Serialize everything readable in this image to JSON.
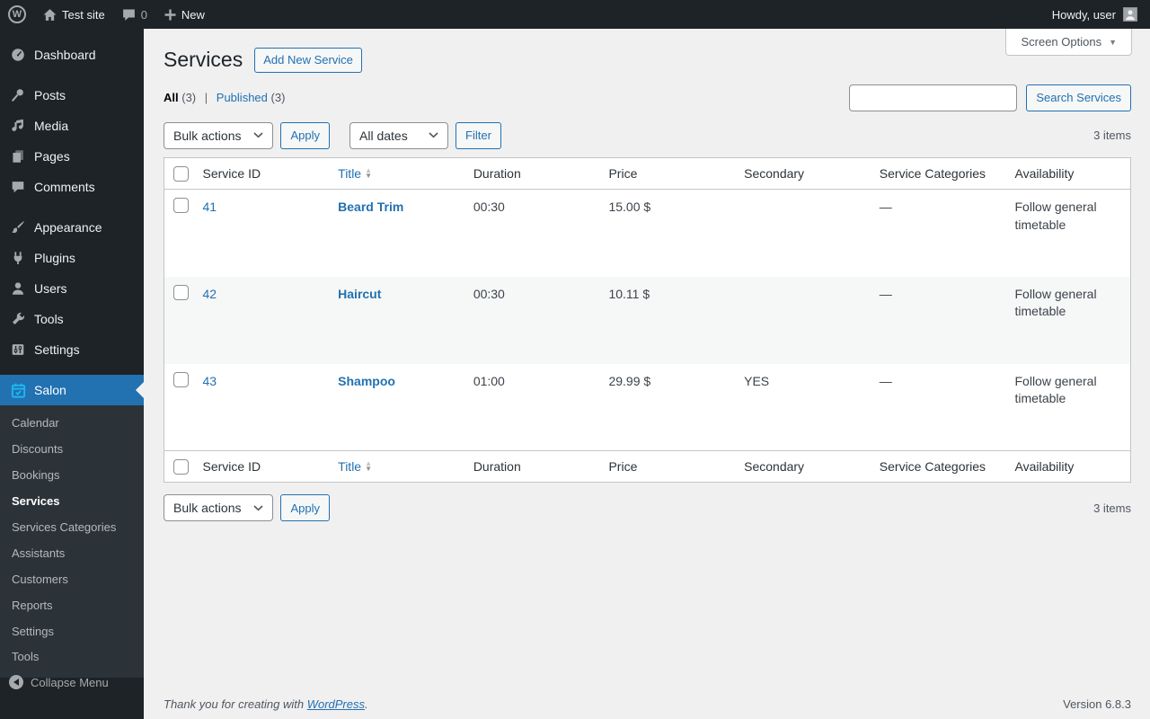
{
  "admin_bar": {
    "logo_letter": "W",
    "site_name": "Test site",
    "comments_count": "0",
    "new_label": "New",
    "howdy": "Howdy, user"
  },
  "sidebar": {
    "items": [
      {
        "label": "Dashboard"
      },
      {
        "label": "Posts"
      },
      {
        "label": "Media"
      },
      {
        "label": "Pages"
      },
      {
        "label": "Comments"
      },
      {
        "label": "Appearance"
      },
      {
        "label": "Plugins"
      },
      {
        "label": "Users"
      },
      {
        "label": "Tools"
      },
      {
        "label": "Settings"
      },
      {
        "label": "Salon"
      }
    ],
    "submenu": [
      {
        "label": "Calendar"
      },
      {
        "label": "Discounts"
      },
      {
        "label": "Bookings"
      },
      {
        "label": "Services"
      },
      {
        "label": "Services Categories"
      },
      {
        "label": "Assistants"
      },
      {
        "label": "Customers"
      },
      {
        "label": "Reports"
      },
      {
        "label": "Settings"
      },
      {
        "label": "Tools"
      }
    ],
    "collapse_label": "Collapse Menu"
  },
  "page": {
    "title": "Services",
    "add_new_label": "Add New Service",
    "screen_options_label": "Screen Options",
    "views": {
      "all_label": "All",
      "all_count": "(3)",
      "separator": "|",
      "published_label": "Published",
      "published_count": "(3)"
    },
    "search": {
      "input_value": "",
      "button_label": "Search Services"
    },
    "bulk_actions_label": "Bulk actions",
    "apply_label": "Apply",
    "dates_filter_label": "All dates",
    "filter_label": "Filter",
    "items_count": "3 items"
  },
  "table": {
    "columns": {
      "service_id": "Service ID",
      "title": "Title",
      "duration": "Duration",
      "price": "Price",
      "secondary": "Secondary",
      "categories": "Service Categories",
      "availability": "Availability"
    },
    "rows": [
      {
        "id": "41",
        "title": "Beard Trim",
        "duration": "00:30",
        "price": "15.00 $",
        "secondary": "",
        "categories": "—",
        "availability": "Follow general timetable"
      },
      {
        "id": "42",
        "title": "Haircut",
        "duration": "00:30",
        "price": "10.11 $",
        "secondary": "",
        "categories": "—",
        "availability": "Follow general timetable"
      },
      {
        "id": "43",
        "title": "Shampoo",
        "duration": "01:00",
        "price": "29.99 $",
        "secondary": "YES",
        "categories": "—",
        "availability": "Follow general timetable"
      }
    ]
  },
  "footer": {
    "thanks_prefix": "Thank you for creating with",
    "wordpress_link": "WordPress",
    "suffix": ".",
    "version": "Version 6.8.3"
  },
  "colors": {
    "accent": "#2271b1",
    "admin_bar_bg": "#1d2327",
    "sidebar_bg": "#1d2327",
    "submenu_bg": "#2c3338",
    "active_menu_bg": "#2271b1",
    "salon_icon": "#1fb6f0",
    "content_bg": "#f0f0f1",
    "striped_row": "#f6f7f7",
    "table_border": "#c3c4c7"
  }
}
